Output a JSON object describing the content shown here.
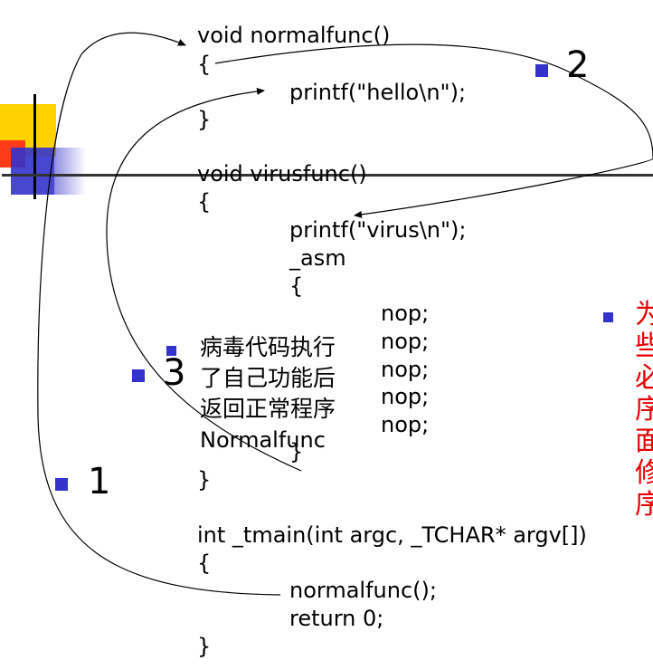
{
  "code": {
    "normalfunc_sig": "void normalfunc()",
    "brace_open_1": "{",
    "printf_hello": "printf(\"hello\\n\");",
    "brace_close_1": "}",
    "virusfunc_sig": "void virusfunc()",
    "brace_open_2": "{",
    "printf_virus": "printf(\"virus\\n\");",
    "asm_kw": "_asm",
    "asm_brace_open": "{",
    "nops": [
      "nop;",
      "nop;",
      "nop;",
      "nop;",
      "nop;"
    ],
    "asm_brace_close": "}",
    "brace_close_2": "}",
    "main_sig": "int _tmain(int argc, _TCHAR* argv[])",
    "brace_open_3": "{",
    "call_normalfunc": "normalfunc();",
    "return_stmt": "return 0;",
    "brace_close_3": "}"
  },
  "annotations": {
    "step1": "1",
    "step2": "2",
    "step3": "3",
    "chinese_note": [
      "病毒代码执行",
      "了自己功能后",
      "返回正常程序",
      "Normalfunc"
    ],
    "right_note_chars": [
      "为",
      "些",
      "必",
      "序",
      "面",
      "修",
      "序"
    ]
  },
  "colors": {
    "bullet": "#3333cc",
    "red_text": "#e60000",
    "deco_yellow": "#ffd200",
    "deco_red": "#ff3300",
    "deco_blue": "#3333cc"
  }
}
